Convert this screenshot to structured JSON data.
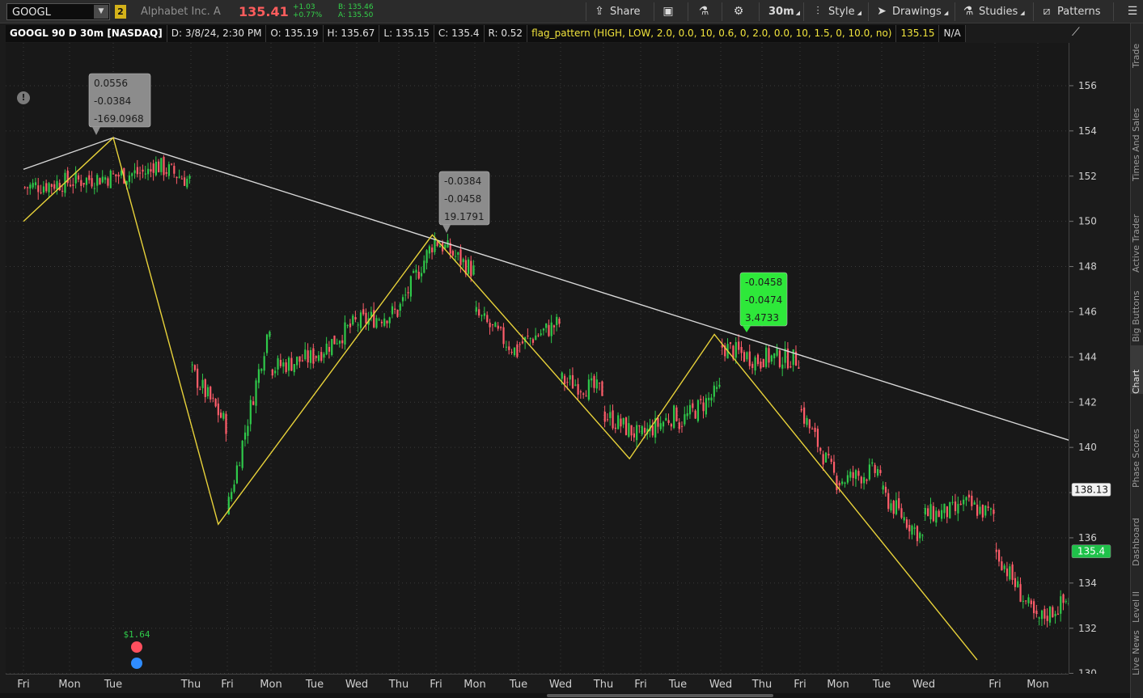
{
  "toolbar": {
    "symbol": "GOOGL",
    "link_group": "2",
    "company": "Alphabet Inc. A",
    "last_price": "135.41",
    "change": "+1.03",
    "change_pct": "+0.77%",
    "bid": "B: 135.46",
    "ask": "A: 135.50",
    "share_label": "Share",
    "timeframe_label": "30m",
    "style_label": "Style",
    "drawings_label": "Drawings",
    "studies_label": "Studies",
    "patterns_label": "Patterns"
  },
  "infobar": {
    "title": "GOOGL 90 D 30m [NASDAQ]",
    "date": "D: 3/8/24, 2:30 PM",
    "open": "O: 135.19",
    "high": "H: 135.67",
    "low": "L: 135.15",
    "close": "C: 135.4",
    "range": "R: 0.52",
    "study": "flag_pattern (HIGH, LOW, 2.0, 0.0, 10, 0.6, 0, 2.0, 0.0, 10, 1.5, 0, 10.0, no)",
    "study_value": "135.15",
    "study_na": "N/A"
  },
  "side_tabs": [
    "Trade",
    "Times And Sales",
    "Active Trader",
    "Big Buttons",
    "Chart",
    "Phase Scores",
    "Dashboard",
    "Level II",
    "Live News"
  ],
  "active_side_tab": "Chart",
  "colors": {
    "up": "#2fc94a",
    "down": "#ff5d6a",
    "zigzag": "#e8d23a",
    "trendline": "#d8d8d8",
    "current_price_bg": "#1fc24a",
    "label_bubble": "#8c8c8c",
    "label_bubble_active": "#2ee83a"
  },
  "annotations": {
    "bubble1": [
      "0.0556",
      "-0.0384",
      "-169.0968"
    ],
    "bubble2": [
      "-0.0384",
      "-0.0458",
      "19.1791"
    ],
    "bubble3": [
      "-0.0458",
      "-0.0474",
      "3.4733"
    ],
    "dividend": "$1.64",
    "price_tag_line": "138.13",
    "price_tag_current": "135.4"
  },
  "chart_data": {
    "type": "candlestick",
    "symbol": "GOOGL",
    "interval": "30m",
    "span": "90 D",
    "ylim": [
      130,
      157
    ],
    "yticks": [
      130,
      132,
      134,
      136,
      138,
      140,
      142,
      144,
      146,
      148,
      150,
      152,
      154,
      156
    ],
    "xticks": [
      "Fri",
      "Mon",
      "Tue",
      "Thu",
      "Fri",
      "Mon",
      "Tue",
      "Wed",
      "Thu",
      "Fri",
      "Mon",
      "Tue",
      "Wed",
      "Thu",
      "Fri",
      "Tue",
      "Wed",
      "Thu",
      "Fri",
      "Mon",
      "Tue",
      "Wed",
      "Fri",
      "Mon"
    ],
    "xtick_index": [
      0,
      2,
      4,
      8,
      10,
      12,
      14,
      16,
      18,
      20,
      22,
      24,
      26,
      28,
      30,
      32,
      34,
      36,
      38,
      40,
      42,
      44,
      48,
      50
    ],
    "segments": [
      {
        "start": 0,
        "end": 6,
        "from": 151.5,
        "to": 152.2
      },
      {
        "start": 6,
        "end": 8,
        "from": 152.6,
        "to": 151.8
      },
      {
        "start": 8,
        "end": 10,
        "from": 143.5,
        "to": 141.0
      },
      {
        "start": 10,
        "end": 12,
        "from": 137.0,
        "to": 145.5
      },
      {
        "start": 12,
        "end": 14,
        "from": 143.5,
        "to": 144.0
      },
      {
        "start": 14,
        "end": 16,
        "from": 144.0,
        "to": 145.5
      },
      {
        "start": 16,
        "end": 18,
        "from": 145.5,
        "to": 146.0
      },
      {
        "start": 18,
        "end": 20,
        "from": 146.0,
        "to": 149.2
      },
      {
        "start": 20,
        "end": 22,
        "from": 149.2,
        "to": 147.8
      },
      {
        "start": 22,
        "end": 24,
        "from": 146.0,
        "to": 144.2
      },
      {
        "start": 24,
        "end": 26,
        "from": 144.5,
        "to": 145.5
      },
      {
        "start": 26,
        "end": 28,
        "from": 143.0,
        "to": 142.5
      },
      {
        "start": 28,
        "end": 30,
        "from": 141.5,
        "to": 140.5
      },
      {
        "start": 30,
        "end": 32,
        "from": 140.5,
        "to": 141.5
      },
      {
        "start": 32,
        "end": 34,
        "from": 141.0,
        "to": 142.5
      },
      {
        "start": 34,
        "end": 36,
        "from": 144.5,
        "to": 143.8
      },
      {
        "start": 36,
        "end": 38,
        "from": 144.0,
        "to": 143.9
      },
      {
        "start": 38,
        "end": 40,
        "from": 141.8,
        "to": 138.5
      },
      {
        "start": 40,
        "end": 42,
        "from": 138.5,
        "to": 139.0
      },
      {
        "start": 42,
        "end": 44,
        "from": 138.0,
        "to": 136.0
      },
      {
        "start": 44,
        "end": 46,
        "from": 137.0,
        "to": 137.2
      },
      {
        "start": 46,
        "end": 48,
        "from": 137.6,
        "to": 137.0
      },
      {
        "start": 48,
        "end": 50,
        "from": 135.6,
        "to": 132.3
      },
      {
        "start": 50,
        "end": 52,
        "from": 132.3,
        "to": 133.6
      }
    ],
    "zigzag": [
      [
        0,
        150.0
      ],
      [
        4,
        153.7
      ],
      [
        9.5,
        136.6
      ],
      [
        19.8,
        149.4
      ],
      [
        29.4,
        139.5
      ],
      [
        33.7,
        145.0
      ],
      [
        47.0,
        130.6
      ]
    ],
    "trendline": [
      [
        0,
        152.3
      ],
      [
        4,
        153.7
      ],
      [
        52.5,
        140.0
      ]
    ]
  }
}
